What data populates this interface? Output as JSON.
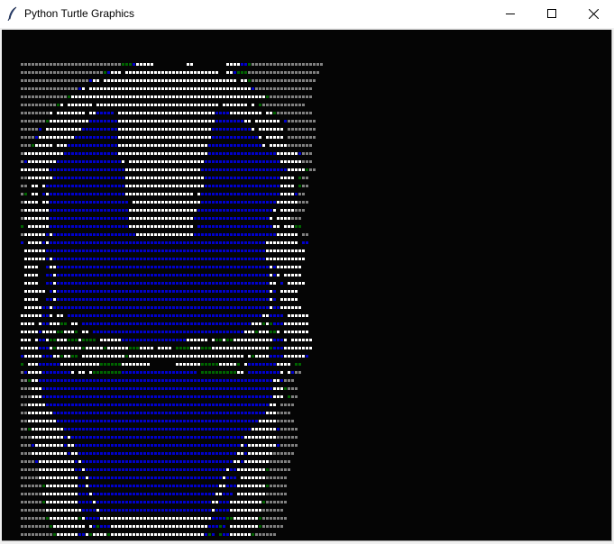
{
  "window": {
    "title": "Python Turtle Graphics",
    "icon": "feather-icon",
    "controls": {
      "minimize": "minimize-icon",
      "maximize": "maximize-icon",
      "close": "close-icon"
    }
  },
  "canvas": {
    "background": "#050505",
    "palette": {
      "g": "#808080",
      "w": "#ffffff",
      "b": "#0000cc",
      "d": "#006400"
    },
    "rows": [
      "ggggggggggggggggggggggggggggdddbwwwww.........ww.........wwwwbbdgggggggggggggggggggg",
      "gggggggggggggggggggggggdbwww.wwwwwwwwwwwwwwwwwwwwwwwwww..wwbdddgggggggggggggggggggg",
      "gggggggggggggggggggbww.wwwwwwwwwwwwwwwwwwwwwwwwwwwwwwwwwwwww.wwdgggggggggggggggggg",
      "ggggggggggggggggbw.wwwwwwwwwwwwwwwwwwwwwwwwwwwwwwwwwwwwwwwwwwwwwbgggggggggggggggg",
      "gggggggggggggdwwwwwwwwwwwwwwwwwwwwwwwwwwwwwwwwwwwwwwwwwwwwwwwwwwwwwwdgggggggggggg",
      "ggggggggggdw.wwwwwww.wwwwwwwwwwwwwwwwwwwwwwwwwwwwwwwwww.wwwwwww.w.dgggggggggggg",
      "ggggggggw.wwwwwwww.wwbbbbb.wwwwwwwwwwwwwwwwwwwwwwwwwwwbbbbwwwwwwwww.wwdgggggggggg",
      "gggggggdwwwwwwwwwwwbbbbbbbbwwwwwwwwwwwwwwwwwwwwwwwwwwwbbbbbbbbww.wwwwwww.bgggggggg",
      "gggggb.wwwwwwwwwwbbbbbbbbbbwwwwwwwwwwwwwwwwwwwwwwwwwwbbbbbbbbbbbw.wwwwwww.gggggggg",
      "ggggbwwwwwwwwwwbbbbbbbbbbbbwwwwwwwwwwwwwwwwwwwwwwwwwwbbbbbbbbbbbbbw.wwwww.gggggggg",
      "gggdwwwww.wwwbbbbbbbbbbbbbbwwwwwwwwwwwwwwwwwwwwwwwwwbbbbbbbbbbbbbbbw.wwwwwggggggg",
      "gwwwwwwwwwwwbbbbbbbbbbbbbbbwwwwwwwwwwwwwwwwwwwwwwwwwbbbbbbbbbbbbbbbbbbbwwwwwwbggg",
      "gbwwwwwwwwbbbbbbbbbbbbbbbbbbw.wwwwwwwwwwwwwwwwwwwwwbbbbbbbbbbbbbbbbbbbbbwwwwwwggg",
      "wwwwwwwwbbbbbbbbbbbbbbbbbbbbbwwwwwwwwwwwwwwwwwwwwwbbbbbbbbbbbbbbbbbbbbbbbbwwwwwdgg",
      "ggwwwwwwwbbbbbbbbbbbbbbbbbbbbwwwwwwwwwwwwwwwwwwwwwwbbbbbbbbbbbbbbbbbbbbbwwww.dgg",
      "gg.ww.wbbbbbbbbbbbbbbbbbbbbbbwwwwwwwwwwwwwwwwwwwwwwbbbbbbbbbbbbbbbbbbbbbwwww.dgg",
      "gd.ww.bwbbbbbbbbbbbbbbbbbbbbbwwwwwwwwwwwwwwwwwww.wbbbbbbbbbbbbbbbbbbbbbbwwwwbgg",
      "gwwww.wwbbbbbbbbbbbbbbbbbbbbbb.wwwwwwwwwwwwwwwwwwwbbbbbbbbbbbbbbbbbbbbbwwwwwwggg",
      "gwwwwwwwbbbbbbbbbbbbbbbbbbbbbbwwwwwwwwwwwwwwwwwwwbbbbbbbbbbbbbbbbbbbbbw.wwwwggg",
      "gwwwwwwwbbbbbbbbbbbbbbbbbbbbbbwwwwwwwwwwwwwwwwwwbbbbbbbbbbbbbbbbbbbbbw.wwwwggg",
      "d.wwwwwwbbbbbbbbbbbbbbbbbbbbbbwwwwwwwwwwwwwwwwww.bbbbbbbbbbbbbbbbbbbbbww.wwwdd",
      "gwwwwwwbwbbbbbbbbbbbbbbbbbbbbbbbwwwwwwwwwwwwwwwwbbbbbbbbbbbbbbbbbbbbbbbwwwwww.gg",
      "b.wwwwbwbbbbbbbbbbbbbbbbbbbbbbbbbbbbbbbbbbbbbbbbbbbbbbbbbbbbbbbbbbbbwwwwwwwww.bb",
      ".wwwwwwbbbbbbbbbbbbbbbbbbbbbbbbbbbbbbbbbbbbbbbbbbbbbbbbbbbbbbbbbbbbbwwwwwwwwwww.",
      ".wwwwwwbwbbbbbbbbbbbbbbbbbbbbbbbbbbbbbbbbbbbbbbbbbbbbbbbbbbbbbbbbbbbwwwwwwwwwww.",
      ".wwww..bwwbbbbbbbbbbbbbbbbbbbbbbbbbbbbbbbbbbbbbbbbbbbbbbbbbbbbbbbbbbbwbwwwwwww..",
      ".wwww..bbwbbbbbbbbbbbbbbbbbbbbbbbbbbbbbbbbbbbbbbbbbbbbbbbbbbbbbbbbbbbwbw.wwwww..",
      ".wwww..bbwbbbbbbbbbbbbbbbbbbbbbbbbbbbbbbbbbbbbbbbbbbbbbbbbbbbbbbbbbbbww.b.wwwww.",
      ".wwwwww.bwbbbbbbbbbbbbbbbbbbbbbbbbbbbbbbbbbbbbbbbbbbbbbbbbbbbbbbbbbbbwb.wwwww..",
      ".wwww..bbwbbbbbbbbbbbbbbbbbbbbbbbbbbbbbbbbbbbbbbbbbbbbbbbbbbbbbbbbbbbwb.wwwww..",
      ".wwwwwbbwbbbbbbbbbbbbbbbbbbbbbbbbbbbbbbbbbbbbbbbbbbbbbbbbbbbbbbbbbbbbwbbwwwwww.",
      "wwwwwwbbw.ww.bbbbbbbbbbbbbbbbbbbbbbbbbbbbbbbbbbbbbbbbbbbbbbbbbbbbbbwwbbbb.wwwwww",
      "wwww.wbbwwwdd.ww.bbbbbbbbbbbbbbbbbbbbbbbbbbbbbbbbbbbbbbbbbbbbbbbwwwdwdbbbwwwwwww",
      "wwwwwbwwwwddwwwd.ww.bbbbbbbbbbbbbbbbbbbbbbbbbbbbbbbbbbbbbbbbbbwwwdwwwddw.wwwwwww",
      "www.wbbwddwwwdddwdddd.wwwwwwbbbbbbbbbbbbbbbbbbwwwwww.wddwddwwwwwwwwwwwbbbw.wwwwww",
      "wwwwwbbbwdwwwwwwwdwwwwwdwwwwwwdddwwww.wwww.ddddwwwdddwwwwwwwwwwwwwwwwdbbbwwwwwwww",
      "bwwwwwbbbwwdwwdd.wwwwwwwwwwwwdwwwwwwwwwwwwwwwwwwwwwwwwwwwwwwww.wdwwwwbbbbwwwwwwb",
      "d.wwwbbbbbbwwwwwwwwwwwddddddwwwwwwww.......wwwwwwwdddddwwwwwd.wbbbbbbbbwwww.dd",
      "gbwwwwbbbbbbbbw.ww.wddddddddbbbbbbbbbbbbbbbbbbbbb.ddddddddddww.bbbbbbbbbw.wbgg",
      "ggdwwbbbbbbbbbbbbbbbbbbbbbbbbbbbbbbbbbbbbbbbbbbbbbbbbbbbbbbbbbbbbbbbbbwwbggg",
      "gggwwwbbbbbbbbbbbbbbbbbbbbbbbbbbbbbbbbbbbbbbbbbbbbbbbbbbbbbbbbbbbbbbbbwwwdggg",
      "gggwwwbbbbbbbbbbbbbbbbbbbbbbbbbbbbbbbbbbbbbbbbbbbbbbbbbbbbbbbbbbbbbbbbwww.dgg",
      "ggwwwwwbbbbbbbbbbbbbbbbbbbbbbbbbbbbbbbbbbbbbbbbbbbbbbbbbbbbbbbbbbbbbbww.gggg",
      "ggwwwwwwwbbbbbbbbbbbbbbbbbbbbbbbbbbbbbbbbbbbbbbbbbbbbbbbbbbbbbbbbbbbwwwgggg",
      "ggwwwwwwwwbbbbbbbbbbbbbbbbbbbbbbbbbbbbbbbbbbbbbbbbbbbbbbbbbbbbbbbbwwwwwggggg",
      "ggdwwwwwwwwwbbbbbbbbbbbbbbbbbbbbbbbbbbbbbbbbbbbbbbbbbbbbbbbbbbbbwwwwwwwbggggg",
      "gggwwwwwwwwwbwbbbbbbbbbbbbbbbbbbbbbbbbbbbbbbbbbbbbbbbbbbbbbbbbwwwwwwwwwgggggg",
      "gggbwwwwwwwwbwwbbbbbbbbbbbbbbbbbbbbbbbbbbbbbbbbbbbbbbbbbbbbbbwbwwwwwwwwbggggg",
      "gggwwwwwwwwwwbwwbbbbbbbbbbbbbbbbbbbbbbbbbbbbbbbbbbbbbbbbbbbbwwbwwwwwwwgggggg",
      "ggggbwwwwwwwwwwbwbbbbbbbbbbbbbbbbbbbbbbbbbbbbbbbbbbbbbbbbbbwwbwwwwwwwgggggg",
      "gggggwwwwwwwwwwbbwbbbbbbbbbbbbbbbbbbbbbbbbbbbbbbbbbbbbbbbwbbwwwwwwwwdgggggg",
      "gggggwwwwwwwwwwwbbwbbbbbbbbbbbbbbbbbbbbbbbbbbbbbbbbbbbbbwbbb.wwwwwwwgggggg",
      "ggggggdwwwwwwwwwbbwbbbbbbbbbbbbbbbbbbbbbbbbbbbbbbbbbbbbwwbbbwwwwwwwwdggggg",
      "ggggggwwwwwwwwwwbbbwbbbbbbbbbbbbbbbbbbbbbbbbbbbbbbbbbbwwbbb.wwwwwwwwgggggg",
      "ggggggdwwwwwwwwwbbbbwbbbbbbbbbbbbbbbbbbbbbbbbbbbbbbbbwwbbbwwwwwwwwwdgggggg",
      "gggggggwwwwwwwwwwbbbbwbbbbbbbbbbbbbbbbbbbbbbbbbbbbbbbwbbbbwwwwwwwwwgggggg",
      "gggggggdwwwwwwwwdwbbbbwwwwwwwwwwwwwwwwwwwwwwwwwwwwwwwbbbbddwwwwwwwdggggggg",
      "ggggggggdwwwwwwwww.wbdbbbwwwwwwwwwwwwwwwwwwwwwwwwwwwbbbdb.wwwwwwwwdgggggg",
      "gggggggggdwwwwwwbbwdwwwwdwwwwwwwwwwwwwwwwwwwwwwwwwwbdb.dbbwwwwwwdgggggg",
      "ggggggggggwwwwwwwbbbbdwwwdbbbbbbbbbbbbbbbbbbbbbbbbbwdwwbbbwwwwwwdgggggg"
    ]
  }
}
